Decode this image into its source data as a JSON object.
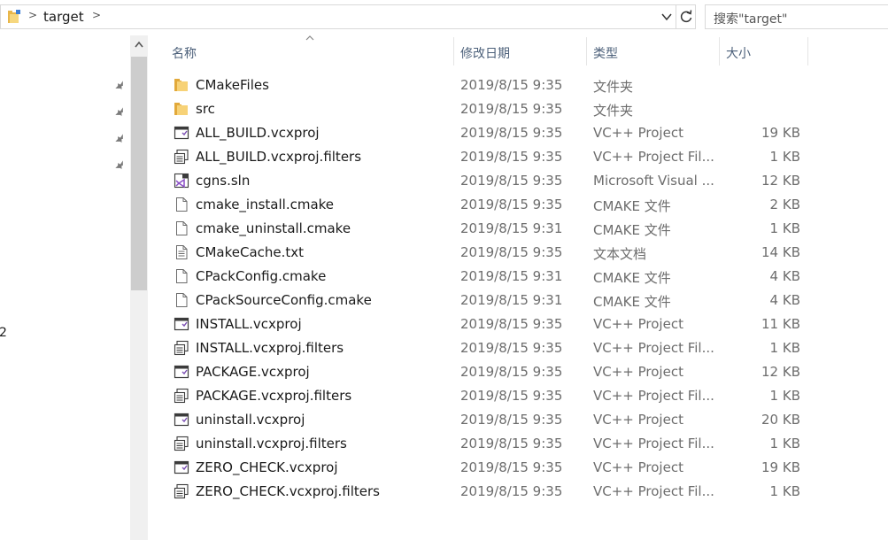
{
  "address": {
    "path": "target",
    "search_placeholder": "搜索\"target\""
  },
  "nav": {
    "partial_text": "2"
  },
  "columns": {
    "name": "名称",
    "date": "修改日期",
    "type": "类型",
    "size": "大小"
  },
  "files": [
    {
      "name": "CMakeFiles",
      "date": "2019/8/15 9:35",
      "type": "文件夹",
      "size": "",
      "icon": "folder-icon"
    },
    {
      "name": "src",
      "date": "2019/8/15 9:35",
      "type": "文件夹",
      "size": "",
      "icon": "folder-icon"
    },
    {
      "name": "ALL_BUILD.vcxproj",
      "date": "2019/8/15 9:35",
      "type": "VC++ Project",
      "size": "19 KB",
      "icon": "vcxproj-icon"
    },
    {
      "name": "ALL_BUILD.vcxproj.filters",
      "date": "2019/8/15 9:35",
      "type": "VC++ Project Fil...",
      "size": "1 KB",
      "icon": "vcxproj-filters-icon"
    },
    {
      "name": "cgns.sln",
      "date": "2019/8/15 9:35",
      "type": "Microsoft Visual ...",
      "size": "12 KB",
      "icon": "sln-icon"
    },
    {
      "name": "cmake_install.cmake",
      "date": "2019/8/15 9:35",
      "type": "CMAKE 文件",
      "size": "2 KB",
      "icon": "file-icon"
    },
    {
      "name": "cmake_uninstall.cmake",
      "date": "2019/8/15 9:31",
      "type": "CMAKE 文件",
      "size": "1 KB",
      "icon": "file-icon"
    },
    {
      "name": "CMakeCache.txt",
      "date": "2019/8/15 9:35",
      "type": "文本文档",
      "size": "14 KB",
      "icon": "text-file-icon"
    },
    {
      "name": "CPackConfig.cmake",
      "date": "2019/8/15 9:31",
      "type": "CMAKE 文件",
      "size": "4 KB",
      "icon": "file-icon"
    },
    {
      "name": "CPackSourceConfig.cmake",
      "date": "2019/8/15 9:31",
      "type": "CMAKE 文件",
      "size": "4 KB",
      "icon": "file-icon"
    },
    {
      "name": "INSTALL.vcxproj",
      "date": "2019/8/15 9:35",
      "type": "VC++ Project",
      "size": "11 KB",
      "icon": "vcxproj-icon"
    },
    {
      "name": "INSTALL.vcxproj.filters",
      "date": "2019/8/15 9:35",
      "type": "VC++ Project Fil...",
      "size": "1 KB",
      "icon": "vcxproj-filters-icon"
    },
    {
      "name": "PACKAGE.vcxproj",
      "date": "2019/8/15 9:35",
      "type": "VC++ Project",
      "size": "12 KB",
      "icon": "vcxproj-icon"
    },
    {
      "name": "PACKAGE.vcxproj.filters",
      "date": "2019/8/15 9:35",
      "type": "VC++ Project Fil...",
      "size": "1 KB",
      "icon": "vcxproj-filters-icon"
    },
    {
      "name": "uninstall.vcxproj",
      "date": "2019/8/15 9:35",
      "type": "VC++ Project",
      "size": "20 KB",
      "icon": "vcxproj-icon"
    },
    {
      "name": "uninstall.vcxproj.filters",
      "date": "2019/8/15 9:35",
      "type": "VC++ Project Fil...",
      "size": "1 KB",
      "icon": "vcxproj-filters-icon"
    },
    {
      "name": "ZERO_CHECK.vcxproj",
      "date": "2019/8/15 9:35",
      "type": "VC++ Project",
      "size": "19 KB",
      "icon": "vcxproj-icon"
    },
    {
      "name": "ZERO_CHECK.vcxproj.filters",
      "date": "2019/8/15 9:35",
      "type": "VC++ Project Fil...",
      "size": "1 KB",
      "icon": "vcxproj-filters-icon"
    }
  ]
}
